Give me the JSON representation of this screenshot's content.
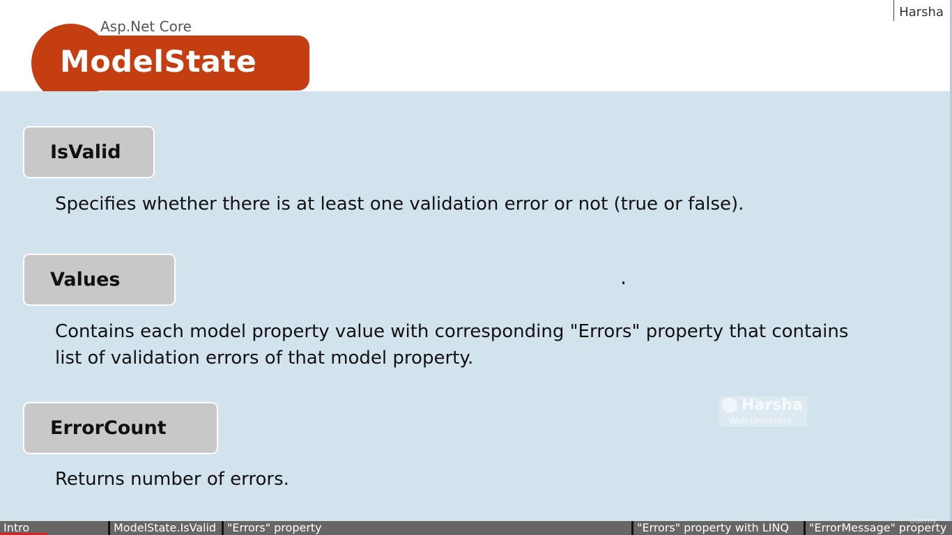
{
  "header": {
    "subtitle": "Asp.Net Core",
    "title": "ModelState",
    "brand": "Harsha",
    "accent_color": "#c43e12"
  },
  "items": [
    {
      "label": "IsValid",
      "description": "Specifies whether there is at least one validation error or not (true or false)."
    },
    {
      "label": "Values",
      "description": "Contains each model property value with corresponding \"Errors\" property that contains list of validation errors of that model property."
    },
    {
      "label": "ErrorCount",
      "description": "Returns number of errors."
    }
  ],
  "watermark": {
    "name": "Harsha",
    "subtitle": "Web University"
  },
  "footer": {
    "provider": "Udemy"
  },
  "chapters": [
    "Intro",
    "ModelState.IsValid",
    "\"Errors\" property",
    "\"Errors\" property with LINQ",
    "\"ErrorMessage\" property"
  ],
  "playback": {
    "progress_fraction": 0.05
  }
}
